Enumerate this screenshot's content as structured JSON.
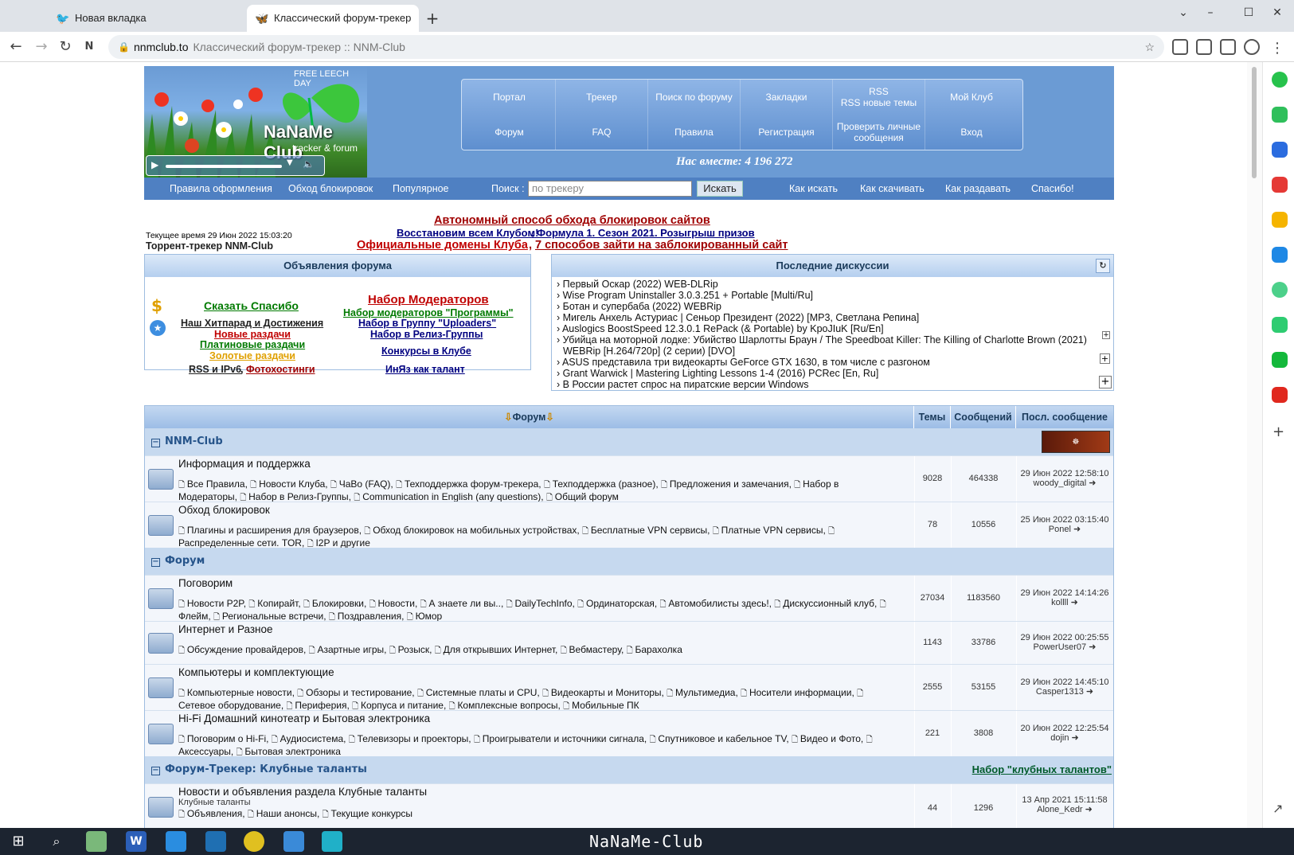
{
  "browser": {
    "tabs": [
      {
        "label": "Новая вкладка"
      },
      {
        "label": "Классический форум-трекер"
      }
    ],
    "url_domain": "nnmclub.to",
    "url_rest": "Классический форум-трекер :: NNM-Club"
  },
  "header": {
    "free_leech": "FREE LEECH DAY",
    "brand": "NaNaMe Club",
    "brand_sub": "tracker & forum",
    "menu": [
      {
        "label": "Портал"
      },
      {
        "label": "Трекер"
      },
      {
        "label": "Поиск по форуму"
      },
      {
        "label": "Закладки"
      },
      {
        "label": "RSS\nRSS новые темы"
      },
      {
        "label": "Мой Клуб"
      },
      {
        "label": "Форум"
      },
      {
        "label": "FAQ"
      },
      {
        "label": "Правила"
      },
      {
        "label": "Регистрация"
      },
      {
        "label": "Проверить личные сообщения"
      },
      {
        "label": "Вход"
      }
    ],
    "together": "Нас вместе: 4 196 272"
  },
  "subnav": {
    "left": [
      "Правила оформления",
      "Обход блокировок",
      "Популярное"
    ],
    "search_label": "Поиск :",
    "search_placeholder": "по трекеру",
    "search_button": "Искать",
    "right": [
      "Как искать",
      "Как скачивать",
      "Как раздавать",
      "Спасибо!"
    ]
  },
  "info": {
    "time": "Текущее время 29 Июн 2022 15:03:20",
    "tracker_title": "Торрент-трекер NNM-Club",
    "notice1": "Автономный способ обхода блокировок сайтов",
    "notice2a": "Восстановим всем Клубом!",
    "notice2b": "Формула 1. Сезон 2021. Розыгрыш призов",
    "notice3a": "Официальные домены Клуба",
    "notice3b": "7 способов зайти на заблокированный сайт"
  },
  "announcements": {
    "title": "Объявления форума",
    "left": [
      "Сказать Спасибо",
      "Наш Хитпарад и Достижения",
      "Новые раздачи",
      "Платиновые раздачи",
      "Золотые раздачи",
      "RSS и IPv6",
      "Фотохостинги"
    ],
    "right": [
      "Набор Модераторов",
      "Набор модераторов \"Программы\"",
      "Набор в Группу \"Uploaders\"",
      "Набор в Релиз-Группы",
      "Конкурсы в Клубе",
      "ИнЯз как талант"
    ]
  },
  "discussions": {
    "title": "Последние дискуссии",
    "items": [
      "› Первый Оскар (2022) WEB-DLRip",
      "› Wise Program Uninstaller 3.0.3.251 + Portable [Multi/Ru]",
      "› Ботан и супербаба (2022) WEBRip",
      "› Мигель Анхель Астуриас | Сеньор Президент (2022) [MP3, Светлана Репина]",
      "› Auslogics BoostSpeed 12.3.0.1 RePack (& Portable) by KpoJIuK [Ru/En]",
      "› Убийца на моторной лодке: Убийство Шарлотты Браун / The Speedboat Killer: The Killing of Charlotte Brown (2021)",
      "WEBRip [H.264/720p] (2 серии) [DVO]",
      "› ASUS представила три видеокарты GeForce GTX 1630, в том числе с разгоном",
      "› Grant Warwick | Mastering Lighting Lessons 1-4 (2016) PCRec [En, Ru]",
      "› В России растет спрос на пиратские версии Windows"
    ]
  },
  "forum": {
    "headers": {
      "forum": "Форум",
      "topics": "Темы",
      "posts": "Сообщений",
      "last": "Посл. сообщение"
    },
    "categories": [
      {
        "name": "NNM-Club"
      },
      {
        "name": "Форум"
      },
      {
        "name": "Форум-Трекер: Клубные таланты",
        "link": "Набор \"клубных талантов\""
      }
    ],
    "rows": [
      {
        "title": "Информация и поддержка",
        "subs": "Все Правила, Новости Клуба, ЧаВо (FAQ), Техподдержка форум-трекера, Техподдержка (разное), Предложения и замечания, Набор в Модераторы, Набор в Релиз-Группы, Communication in English (any questions), Общий форум",
        "topics": "9028",
        "posts": "464338",
        "date": "29 Июн 2022 12:58:10",
        "user": "woody_digital"
      },
      {
        "title": "Обход блокировок",
        "subs": "Плагины и расширения для браузеров, Обход блокировок на мобильных устройствах, Бесплатные VPN сервисы, Платные VPN сервисы, Распределенные сети. TOR, I2P и другие",
        "topics": "78",
        "posts": "10556",
        "date": "25 Июн 2022 03:15:40",
        "user": "Ponel"
      },
      {
        "title": "Поговорим",
        "subs": "Новости P2P, Копирайт, Блокировки, Новости, А знаете ли вы.., DailyTechInfo, Ординаторская, Автомобилисты здесь!, Дискуссионный клуб, Флейм, Региональные встречи, Поздравления, Юмор",
        "topics": "27034",
        "posts": "1183560",
        "date": "29 Июн 2022 14:14:26",
        "user": "kollll"
      },
      {
        "title": "Интернет и Разное",
        "subs": "Обсуждение провайдеров, Азартные игры, Розыск, Для открывших Интернет, Вебмастеру, Барахолка",
        "topics": "1143",
        "posts": "33786",
        "date": "29 Июн 2022 00:25:55",
        "user": "PowerUser07"
      },
      {
        "title": "Компьютеры и комплектующие",
        "subs": "Компьютерные новости, Обзоры и тестирование, Системные платы и CPU, Видеокарты и Мониторы, Мультимедиа, Носители информации, Сетевое оборудование, Периферия, Корпуса и питание, Комплексные вопросы, Мобильные ПК",
        "topics": "2555",
        "posts": "53155",
        "date": "29 Июн 2022 14:45:10",
        "user": "Casper1313"
      },
      {
        "title": "Hi-Fi Домашний кинотеатр и Бытовая электроника",
        "subs": "Поговорим о Hi-Fi, Аудиосистема, Телевизоры и проекторы, Проигрыватели и источники сигнала, Спутниковое и кабельное TV, Видео и Фото, Аксессуары, Бытовая электроника",
        "topics": "221",
        "posts": "3808",
        "date": "20 Июн 2022 12:25:54",
        "user": "dojin"
      },
      {
        "title": "Новости и объявления раздела Клубные таланты",
        "desc": "Клубные таланты",
        "subs": "Объявления, Наши анонсы, Текущие конкурсы",
        "topics": "44",
        "posts": "1296",
        "date": "13 Апр 2021 15:11:58",
        "user": "Alone_Kedr"
      }
    ]
  },
  "taskbar": {
    "label": "NaNaMe-Club"
  },
  "colors": {
    "header_blue": "#6b9bd4",
    "subnav_blue": "#4f80c2",
    "category": "#c6d9ef",
    "row": "#f3f6fb",
    "link_red": "#c00000",
    "link_green": "#007a00",
    "link_navy": "#000080",
    "gold": "#e0a000"
  }
}
